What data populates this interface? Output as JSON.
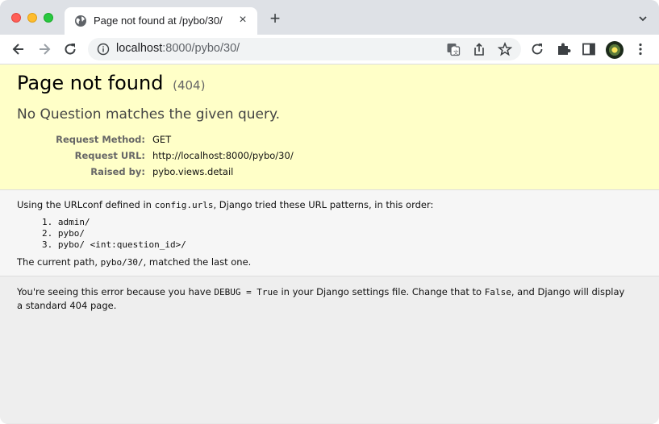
{
  "browser": {
    "tab_title": "Page not found at /pybo/30/",
    "url_host": "localhost",
    "url_rest": ":8000/pybo/30/"
  },
  "page": {
    "title": "Page not found",
    "status_code": "(404)",
    "exception": "No Question matches the given query.",
    "meta": [
      {
        "label": "Request Method:",
        "value": "GET"
      },
      {
        "label": "Request URL:",
        "value": "http://localhost:8000/pybo/30/"
      },
      {
        "label": "Raised by:",
        "value": "pybo.views.detail"
      }
    ],
    "urlconf_intro_before": "Using the URLconf defined in ",
    "urlconf_module": "config.urls",
    "urlconf_intro_after": ", Django tried these URL patterns, in this order:",
    "patterns": [
      {
        "num": "1.",
        "pattern": "admin/"
      },
      {
        "num": "2.",
        "pattern": "pybo/"
      },
      {
        "num": "3.",
        "pattern": "pybo/ <int:question_id>/"
      }
    ],
    "current_before": "The current path, ",
    "current_path": "pybo/30/",
    "current_after": ", matched the last one.",
    "explanation_1": "You're seeing this error because you have ",
    "explanation_debug": "DEBUG = True",
    "explanation_2": " in your Django settings file. Change that to ",
    "explanation_false": "False",
    "explanation_3": ", and Django will display a standard 404 page."
  }
}
